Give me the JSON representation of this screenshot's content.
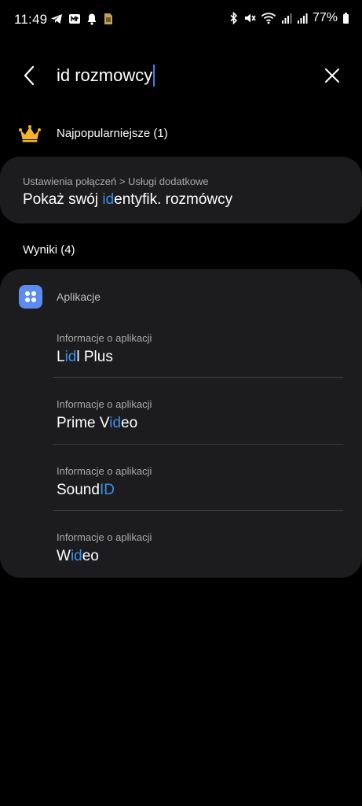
{
  "status_bar": {
    "time": "11:49",
    "battery": "77%",
    "left_icons": [
      "telegram-icon",
      "mail-icon",
      "notification-bell-icon",
      "sim-card-icon"
    ],
    "right_icons": [
      "bluetooth-icon",
      "mute-icon",
      "wifi-icon",
      "signal-icon",
      "signal-icon",
      "battery-icon"
    ]
  },
  "search": {
    "value": "id rozmowcy",
    "back_icon": "back-arrow-icon",
    "clear_icon": "close-icon"
  },
  "popular": {
    "title": "Najpopularniejsze (1)",
    "icon": "crown-icon",
    "item": {
      "path": "Ustawienia połączeń > Usługi dodatkowe",
      "title_before": "Pokaż swój ",
      "title_highlight": "id",
      "title_after": "entyfik. rozmówcy"
    }
  },
  "results": {
    "title": "Wyniki (4)",
    "category": "Aplikacje",
    "category_icon": "apps-icon",
    "items": [
      {
        "sub": "Informacje o aplikacji",
        "before": "L",
        "highlight": "id",
        "after": "l Plus"
      },
      {
        "sub": "Informacje o aplikacji",
        "before": "Prime V",
        "highlight": "id",
        "after": "eo"
      },
      {
        "sub": "Informacje o aplikacji",
        "before": "Sound",
        "highlight": "ID",
        "after": ""
      },
      {
        "sub": "Informacje o aplikacji",
        "before": "W",
        "highlight": "id",
        "after": "eo"
      }
    ]
  },
  "colors": {
    "background": "#000000",
    "card": "#1c1c1e",
    "highlight": "#3b8eea",
    "caret": "#3b82f6",
    "crown": "#f5b42a",
    "apps_icon": "#5b8dee"
  }
}
